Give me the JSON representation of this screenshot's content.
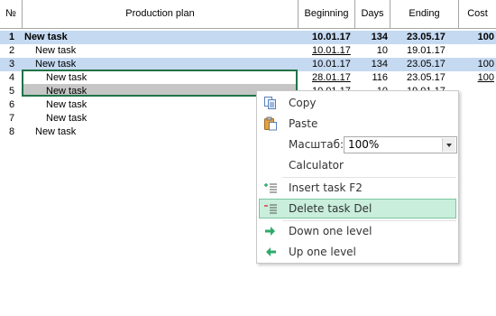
{
  "header": {
    "col_num": "№",
    "col_plan": "Production plan",
    "col_beginning": "Beginning",
    "col_days": "Days",
    "col_ending": "Ending",
    "col_cost": "Cost"
  },
  "rows": [
    {
      "num": "1",
      "name": "New task",
      "beginning": "10.01.17",
      "days": "134",
      "ending": "23.05.17",
      "cost": "100"
    },
    {
      "num": "2",
      "name": "New task",
      "beginning": "10.01.17",
      "days": "10",
      "ending": "19.01.17",
      "cost": ""
    },
    {
      "num": "3",
      "name": "New task",
      "beginning": "10.01.17",
      "days": "134",
      "ending": "23.05.17",
      "cost": "100"
    },
    {
      "num": "4",
      "name": "New task",
      "beginning": "28.01.17",
      "days": "116",
      "ending": "23.05.17",
      "cost": "100"
    },
    {
      "num": "5",
      "name": "New task",
      "beginning": "10.01.17",
      "days": "10",
      "ending": "19.01.17",
      "cost": ""
    },
    {
      "num": "6",
      "name": "New task",
      "beginning": "",
      "days": "",
      "ending": "",
      "cost": ""
    },
    {
      "num": "7",
      "name": "New task",
      "beginning": "",
      "days": "",
      "ending": "",
      "cost": ""
    },
    {
      "num": "8",
      "name": "New task",
      "beginning": "",
      "days": "",
      "ending": "",
      "cost": ""
    }
  ],
  "menu": {
    "copy": "Copy",
    "paste": "Paste",
    "scale_label": "Масштаб:",
    "scale_value": "100%",
    "calculator": "Calculator",
    "insert_task": "Insert task  F2",
    "delete_task": "Delete task Del",
    "down_level": "Down one level",
    "up_level": "Up one level"
  },
  "colors": {
    "row_highlight": "#c5d9f1",
    "selection_border": "#217346",
    "menu_active": "#c9eedc",
    "arrow_green": "#2eaa6a"
  }
}
